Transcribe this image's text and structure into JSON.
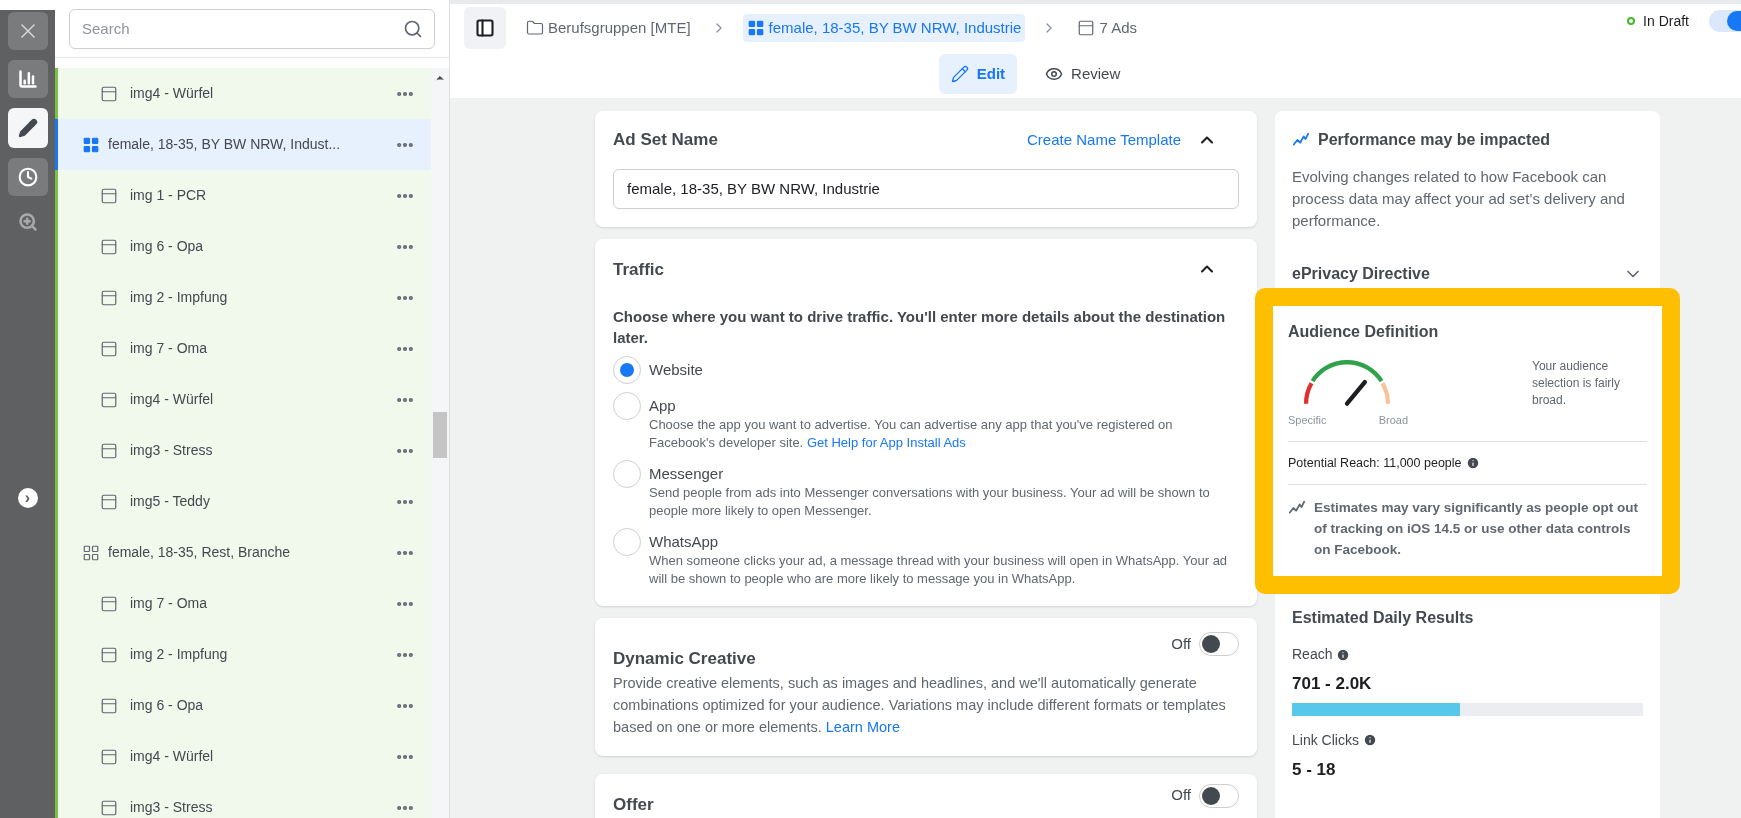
{
  "rail": {
    "expand": "›"
  },
  "sidebar": {
    "search": {
      "placeholder": "Search"
    },
    "tree": [
      {
        "kind": "ad",
        "label": "img4 - Würfel"
      },
      {
        "kind": "adset",
        "label": "female, 18-35, BY BW NRW, Indust...",
        "selected": true,
        "children": [
          {
            "kind": "ad",
            "label": "img 1 - PCR"
          },
          {
            "kind": "ad",
            "label": "img 6 - Opa"
          },
          {
            "kind": "ad",
            "label": "img 2 - Impfung"
          },
          {
            "kind": "ad",
            "label": "img 7 - Oma"
          },
          {
            "kind": "ad",
            "label": "img4 - Würfel"
          },
          {
            "kind": "ad",
            "label": "img3 - Stress"
          },
          {
            "kind": "ad",
            "label": "img5 - Teddy"
          }
        ]
      },
      {
        "kind": "adset",
        "label": "female, 18-35, Rest, Branche",
        "selected": false,
        "children": [
          {
            "kind": "ad",
            "label": "img 7 - Oma"
          },
          {
            "kind": "ad",
            "label": "img 2 - Impfung"
          },
          {
            "kind": "ad",
            "label": "img 6 - Opa"
          },
          {
            "kind": "ad",
            "label": "img4 - Würfel"
          },
          {
            "kind": "ad",
            "label": "img3 - Stress"
          }
        ]
      }
    ]
  },
  "breadcrumb": [
    {
      "kind": "campaign",
      "label": "Berufsgruppen [MTE]",
      "selected": false
    },
    {
      "kind": "adset",
      "label": "female, 18-35, BY BW NRW, Industrie",
      "selected": true
    },
    {
      "kind": "ads",
      "label": "7 Ads",
      "selected": false
    }
  ],
  "status": {
    "label": "In Draft",
    "color": "#42b72a",
    "on": true
  },
  "modes": [
    {
      "kind": "edit",
      "label": "Edit",
      "selected": true
    },
    {
      "kind": "review",
      "label": "Review",
      "selected": false
    }
  ],
  "ad_set_name": {
    "title": "Ad Set Name",
    "link": "Create Name Template",
    "expanded": true,
    "value": "female, 18-35, BY BW NRW, Industrie"
  },
  "traffic": {
    "title": "Traffic",
    "expanded": true,
    "prompt": "Choose where you want to drive traffic. You'll enter more details about the destination later.",
    "options": [
      {
        "label": "Website",
        "selected": true
      },
      {
        "label": "App",
        "selected": false,
        "description": "Choose the app you want to advertise. You can advertise any app that you've registered on Facebook's developer site.",
        "link": "Get Help for App Install Ads"
      },
      {
        "label": "Messenger",
        "selected": false,
        "description": "Send people from ads into Messenger conversations with your business. Your ad will be shown to people more likely to open Messenger."
      },
      {
        "label": "WhatsApp",
        "selected": false,
        "description": "When someone clicks your ad, a message thread with your business will open in WhatsApp. Your ad will be shown to people who are more likely to message you in WhatsApp."
      }
    ]
  },
  "dynamic_creative": {
    "title": "Dynamic Creative",
    "toggle_label": "Off",
    "on": false,
    "description": "Provide creative elements, such as images and headlines, and we'll automatically generate combinations optimized for your audience. Variations may include different formats or templates based on one or more elements.",
    "link": "Learn More"
  },
  "offer": {
    "title": "Offer",
    "toggle_label": "Off",
    "on": false
  },
  "performance": {
    "title": "Performance may be impacted",
    "text": "Evolving changes related to how Facebook can process data may affect your ad set’s delivery and performance.",
    "eprivacy": {
      "title": "ePrivacy Directive",
      "expanded": false
    }
  },
  "audience": {
    "title": "Audience Definition",
    "gauge": {
      "min_label": "Specific",
      "max_label": "Broad"
    },
    "summary": "Your audience selection is fairly broad.",
    "potential_reach": "Potential Reach: 11,000 people",
    "note": "Estimates may vary significantly as people opt out of tracking on iOS 14.5 or use other data controls on Facebook."
  },
  "estimated": {
    "title": "Estimated Daily Results",
    "metrics": [
      {
        "label": "Reach",
        "value": "701 - 2.0K",
        "level": 0.48
      },
      {
        "label": "Link Clicks",
        "value": "5 - 18"
      }
    ]
  }
}
